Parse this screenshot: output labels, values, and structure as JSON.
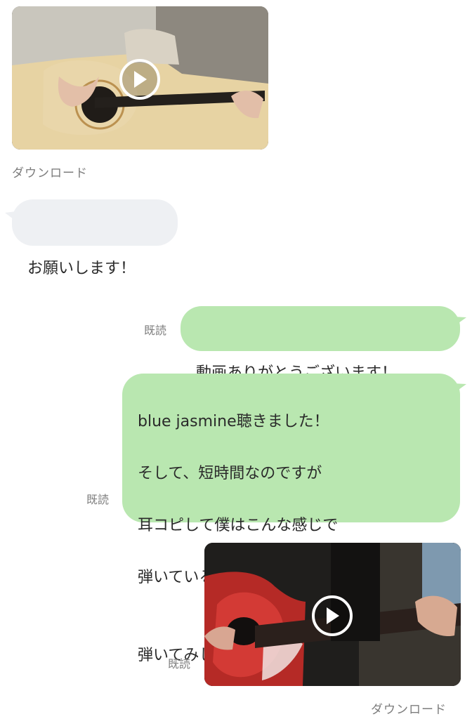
{
  "messages": {
    "video_incoming": {
      "download_label": "ダウンロード"
    },
    "text_incoming": "お願いします！",
    "text_outgoing_1": {
      "read": "既読",
      "text": "動画ありがとうございます！"
    },
    "text_outgoing_2": {
      "read": "既読",
      "lines": [
        "blue jasmine聴きました！",
        "そして、短時間なのですが",
        "耳コピして僕はこんな感じで",
        "弾いているんじゃないかなと思って",
        "弾いてみした"
      ],
      "emoji": "👇"
    },
    "video_outgoing": {
      "read": "既読",
      "download_label": "ダウンロード"
    }
  },
  "colors": {
    "incoming_bubble": "#eef0f3",
    "outgoing_bubble": "#b9e7b0",
    "meta_text": "#7d7d7d"
  },
  "icons": {
    "play": "play-icon"
  }
}
